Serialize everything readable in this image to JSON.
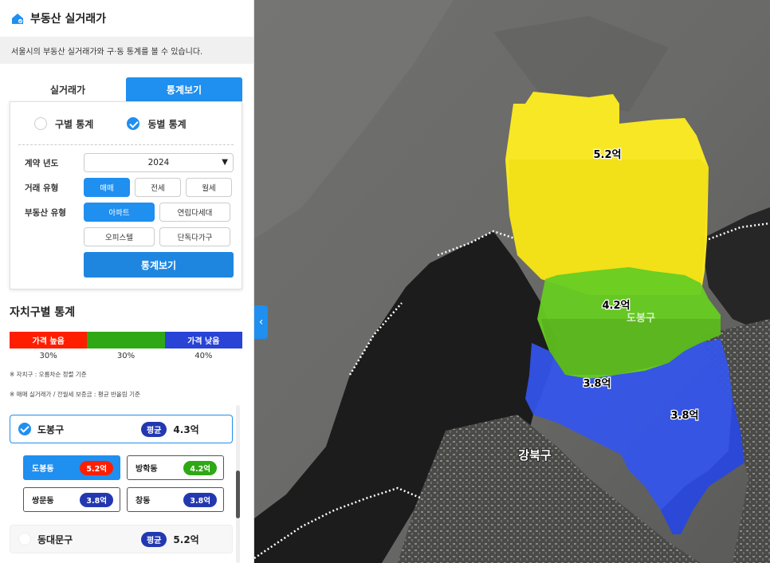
{
  "app": {
    "title": "부동산 실거래가",
    "description": "서울시의 부동산 실거래가와 구·동 통계를 볼 수 있습니다."
  },
  "tabs": [
    {
      "label": "실거래가",
      "active": false
    },
    {
      "label": "통계보기",
      "active": true
    }
  ],
  "filters": {
    "stat_types": [
      {
        "label": "구별 통계",
        "checked": false
      },
      {
        "label": "동별 통계",
        "checked": true
      }
    ],
    "year_label": "계약 년도",
    "year_value": "2024",
    "deal_label": "거래 유형",
    "deal_options": [
      "매매",
      "전세",
      "월세"
    ],
    "deal_selected": "매매",
    "property_label": "부동산 유형",
    "property_options": [
      "아파트",
      "연립다세대",
      "오피스텔",
      "단독다가구"
    ],
    "property_selected": "아파트",
    "submit_label": "통계보기"
  },
  "stats": {
    "title": "자치구별 통계",
    "legend": [
      {
        "label": "가격 높음",
        "pct": "30%",
        "color": "#ff1e00"
      },
      {
        "label": "",
        "pct": "30%",
        "color": "#2ea814"
      },
      {
        "label": "가격 낮음",
        "pct": "40%",
        "color": "#2843d6"
      }
    ],
    "note1": "※ 자치구 : 오름차순 정렬 기준",
    "note2": "※ 매매 실거래가 / 전월세 보증금 : 평균 반올림 기준"
  },
  "districts": [
    {
      "name": "도봉구",
      "avg_label": "평균",
      "avg": "4.3억",
      "selected": true,
      "dongs": [
        {
          "name": "도봉동",
          "price": "5.2억",
          "color": "#ff1e00",
          "selected": true
        },
        {
          "name": "방학동",
          "price": "4.2억",
          "color": "#2ea814",
          "selected": false
        },
        {
          "name": "쌍문동",
          "price": "3.8억",
          "color": "#2338b0",
          "selected": false
        },
        {
          "name": "창동",
          "price": "3.8억",
          "color": "#2338b0",
          "selected": false
        }
      ]
    },
    {
      "name": "동대문구",
      "avg_label": "평균",
      "avg": "5.2억",
      "selected": false
    }
  ],
  "map": {
    "labels": {
      "dobong_dong": "5.2억",
      "banghak_dong": "4.2억",
      "ssangmun_dong": "3.8억",
      "chang_dong": "3.8억",
      "dobong_gu": "도봉구",
      "gangbuk_gu": "강북구"
    },
    "colors": {
      "high": "#ffee22",
      "mid": "#66cc22",
      "low": "#3355ee"
    }
  }
}
